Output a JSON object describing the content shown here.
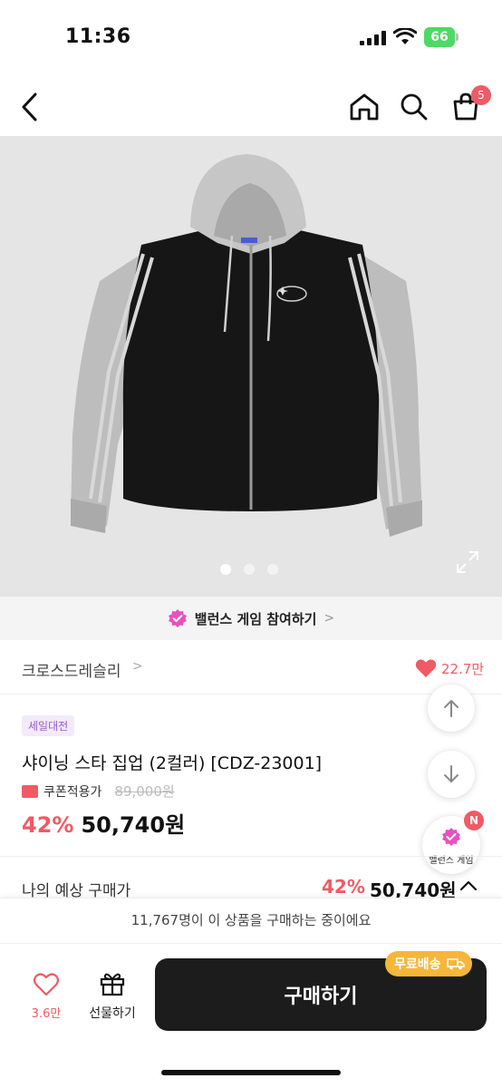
{
  "status_bar": {
    "time": "11:36",
    "battery": "66"
  },
  "nav": {
    "cart_count": "5"
  },
  "gallery": {
    "dot_count": 3,
    "active_index": 0
  },
  "banner": {
    "label": "밸런스 게임 참여하기",
    "chevron": ">"
  },
  "brand": {
    "name": "크로스드레슬리",
    "chevron": ">",
    "likes": "22.7만"
  },
  "product": {
    "sale_tag": "세일대전",
    "title": "샤이닝 스타 집업 (2컬러) [CDZ-23001]",
    "coupon_label": "쿠폰적용가",
    "original_price": "89,000원",
    "discount": "42%",
    "price": "50,740원"
  },
  "floating": {
    "game_label": "밸런스 게임",
    "game_badge": "N"
  },
  "expected": {
    "label": "나의 예상 구매가",
    "discount": "42%",
    "price": "50,740원"
  },
  "buyers": {
    "text": "11,767명이 이 상품을 구매하는 중이에요"
  },
  "bottom": {
    "wish_count": "3.6만",
    "gift_label": "선물하기",
    "buy_label": "구매하기",
    "free_shipping": "무료배송"
  },
  "colors": {
    "accent": "#f05a64",
    "sale_tag_bg": "#f3eafc",
    "sale_tag_text": "#9b59d0",
    "buy_button": "#1c1c1c",
    "free_ship": "#f6b63a"
  }
}
